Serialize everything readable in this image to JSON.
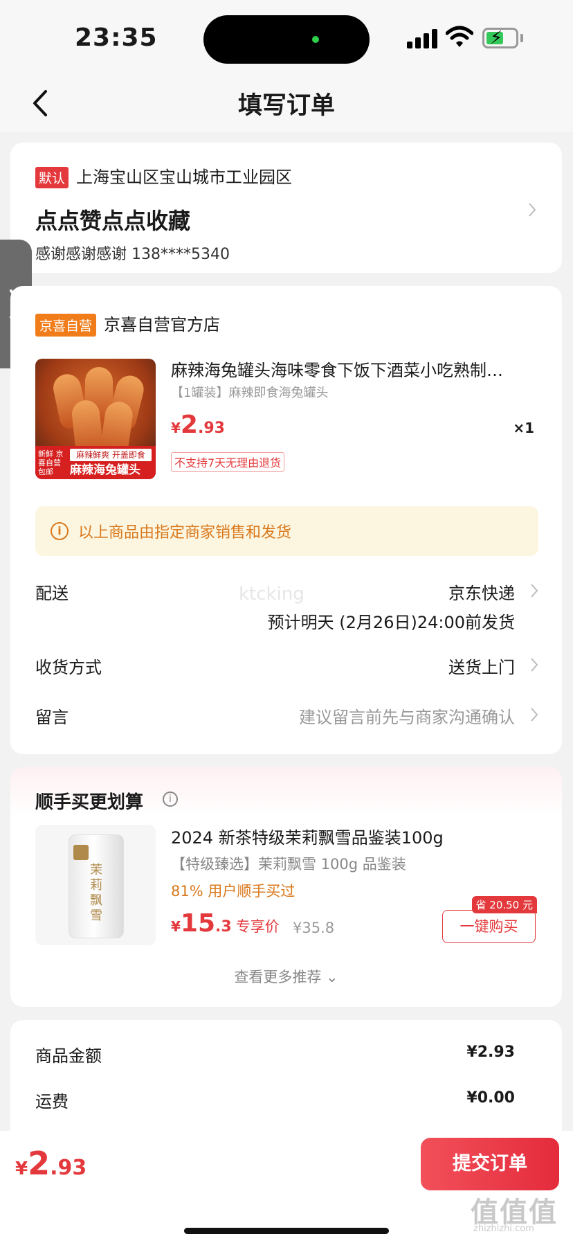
{
  "status": {
    "time": "23:35"
  },
  "nav": {
    "title": "填写订单"
  },
  "address": {
    "default_tag": "默认",
    "location": "上海宝山区宝山城市工业园区",
    "name": "点点赞点点收藏",
    "contact": "感谢感谢感谢  138****5340"
  },
  "shop": {
    "tag": "京喜自营",
    "name": "京喜自营官方店"
  },
  "product": {
    "title": "麻辣海兔罐头海味零食下饭下酒菜小吃熟制…",
    "spec": "【1罐装】麻辣即食海兔罐头",
    "price_symbol": "¥",
    "price_int": "2",
    "price_dec": ".93",
    "qty": "×1",
    "return_tag": "不支持7天无理由退货",
    "image_banner_top": "麻辣鲜爽 开盖即食",
    "image_banner_main": "麻辣海兔罐头",
    "image_banner_left": "新鲜 京喜自营 包邮"
  },
  "notice": {
    "icon": "i",
    "text": "以上商品由指定商家销售和发货"
  },
  "delivery": {
    "label": "配送",
    "value": "京东快递",
    "estimate": "预计明天 (2月26日)24:00前发货",
    "watermark": "ktcking"
  },
  "receive": {
    "label": "收货方式",
    "value": "送货上门"
  },
  "message": {
    "label": "留言",
    "placeholder": "建议留言前先与商家沟通确认"
  },
  "recommend": {
    "title": "顺手买更划算",
    "info_icon": "i",
    "item_name": "2024 新茶特级茉莉飘雪品鉴装100g",
    "item_spec": "【特级臻选】茉莉飘雪 100g 品鉴装",
    "item_pct": "81% 用户顺手买过",
    "price_symbol": "¥",
    "price_int": "15",
    "price_dec": ".3",
    "exclusive": "专享价",
    "orig_price": "¥35.8",
    "save_badge": "省 20.50 元",
    "buy_label": "一键购买",
    "tin_label": "茉莉飘雪",
    "more": "查看更多推荐 ⌄"
  },
  "summary": {
    "goods_label": "商品金额",
    "goods_value": "¥2.93",
    "shipping_label": "运费",
    "shipping_value": "¥0.00"
  },
  "bottom": {
    "price_symbol": "¥",
    "price_int": "2",
    "price_dec": ".93",
    "submit": "提交订单",
    "watermark": "值值值",
    "watermark_sub": "zhizhizhi.com"
  }
}
